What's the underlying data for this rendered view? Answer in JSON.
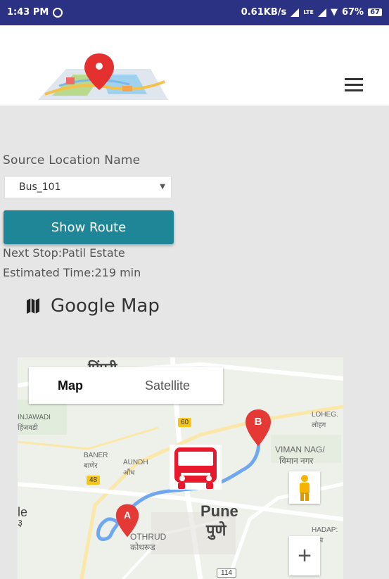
{
  "status_bar": {
    "time": "1:43 PM",
    "network_speed": "0.61KB/s",
    "lte": "LTE",
    "battery_percent": "67%",
    "battery_level": "67"
  },
  "header": {
    "logo_icon": "map-pin-logo",
    "menu_icon": "hamburger-icon"
  },
  "form": {
    "source_label": "Source Location Name",
    "source_value": "Bus_101",
    "show_route_label": "Show Route"
  },
  "info": {
    "next_stop": "Next Stop:Patil Estate",
    "estimated_time": "Estimated Time:219 min"
  },
  "map_section": {
    "heading": "Google Map",
    "map_type_map": "Map",
    "map_type_satellite": "Satellite",
    "labels": {
      "pimpri": "पिंपरी",
      "hinjawadi": "INJAWADI",
      "hinjawadi_hi": "हिंजवडी",
      "baner": "BANER",
      "baner_hi": "बाणेर",
      "aundh": "AUNDH",
      "aundh_hi": "औंध",
      "lohegaon": "LOHEG.",
      "lohegaon_hi": "लोहग",
      "viman_nagar": "VIMAN NAG/",
      "viman_nagar_hi": "विमान नगर",
      "pune": "Pune",
      "pune_hi": "पुणे",
      "kothrud": "OTHRUD",
      "kothrud_hi": "कोथरूड",
      "hadapsar": "HADAP:",
      "hadapsar_hi": "हडप",
      "road_60": "60",
      "road_48": "48",
      "road_114": "114",
      "edge_le": "le",
      "edge_3": "३"
    },
    "marker_a": "A",
    "marker_b": "B",
    "zoom_in": "+",
    "route_color": "#6fa8f0",
    "marker_color": "#e53935",
    "bus_color": "#e8192c"
  }
}
